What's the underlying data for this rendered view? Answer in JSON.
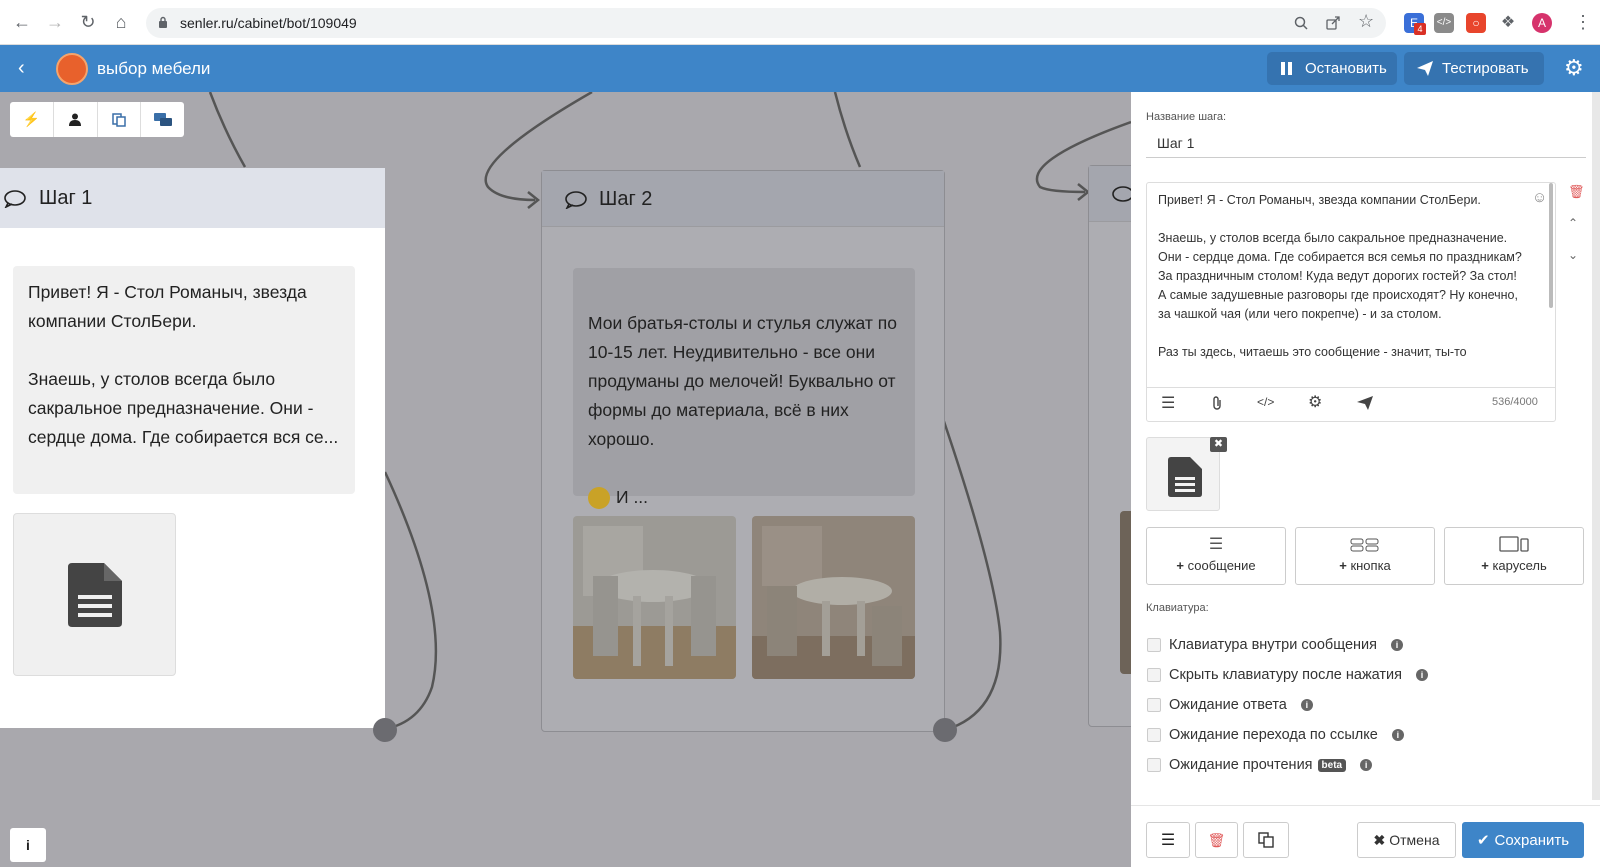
{
  "browser": {
    "url": "senler.ru/cabinet/bot/109049",
    "avatar_letter": "A",
    "ext_badge": "4"
  },
  "header": {
    "title": "выбор мебели",
    "stop_label": "Остановить",
    "test_label": "Тестировать"
  },
  "canvas": {
    "steps": [
      {
        "title": "Шаг 1",
        "text": "Привет! Я - Стол Романыч, звезда компании СтолБери.\n\nЗнаешь, у столов всегда было сакральное предназначение. Они - сердце дома. Где собирается вся се..."
      },
      {
        "title": "Шаг 2",
        "text": "Мои братья-столы и стулья служат по 10-15 лет. Неудивительно - все они продуманы до мелочей! Буквально от формы до материала, всё в них хорошо.",
        "text_tail": "И ..."
      }
    ]
  },
  "panel": {
    "step_name_label": "Название шага:",
    "step_name_value": "Шаг 1",
    "message_text": "Привет! Я - Стол Романыч, звезда компании СтолБери.\n\nЗнаешь, у столов всегда было сакральное предназначение. Они - сердце дома. Где собирается вся семья по праздникам? За праздничным столом! Куда ведут дорогих гостей?  За стол! А самые задушевные разговоры где происходят? Ну конечно, за чашкой чая (или чего покрепче) - и за столом.\n\nРаз ты здесь, читаешь это сообщение - значит, ты-то",
    "char_count": "536/4000",
    "add_buttons": [
      {
        "label": "сообщение"
      },
      {
        "label": "кнопка"
      },
      {
        "label": "карусель"
      }
    ],
    "keyboard_label": "Клавиатура:",
    "options": [
      {
        "label": "Клавиатура внутри сообщения"
      },
      {
        "label": "Скрыть клавиатуру после нажатия"
      },
      {
        "label": "Ожидание ответа"
      },
      {
        "label": "Ожидание перехода по ссылке"
      },
      {
        "label": "Ожидание прочтения",
        "badge": "beta"
      }
    ],
    "cancel_label": "Отмена",
    "save_label": "Сохранить"
  },
  "colors": {
    "appbar": "#3e85c8",
    "save": "#3e85c8",
    "delete": "#e05a5a"
  }
}
